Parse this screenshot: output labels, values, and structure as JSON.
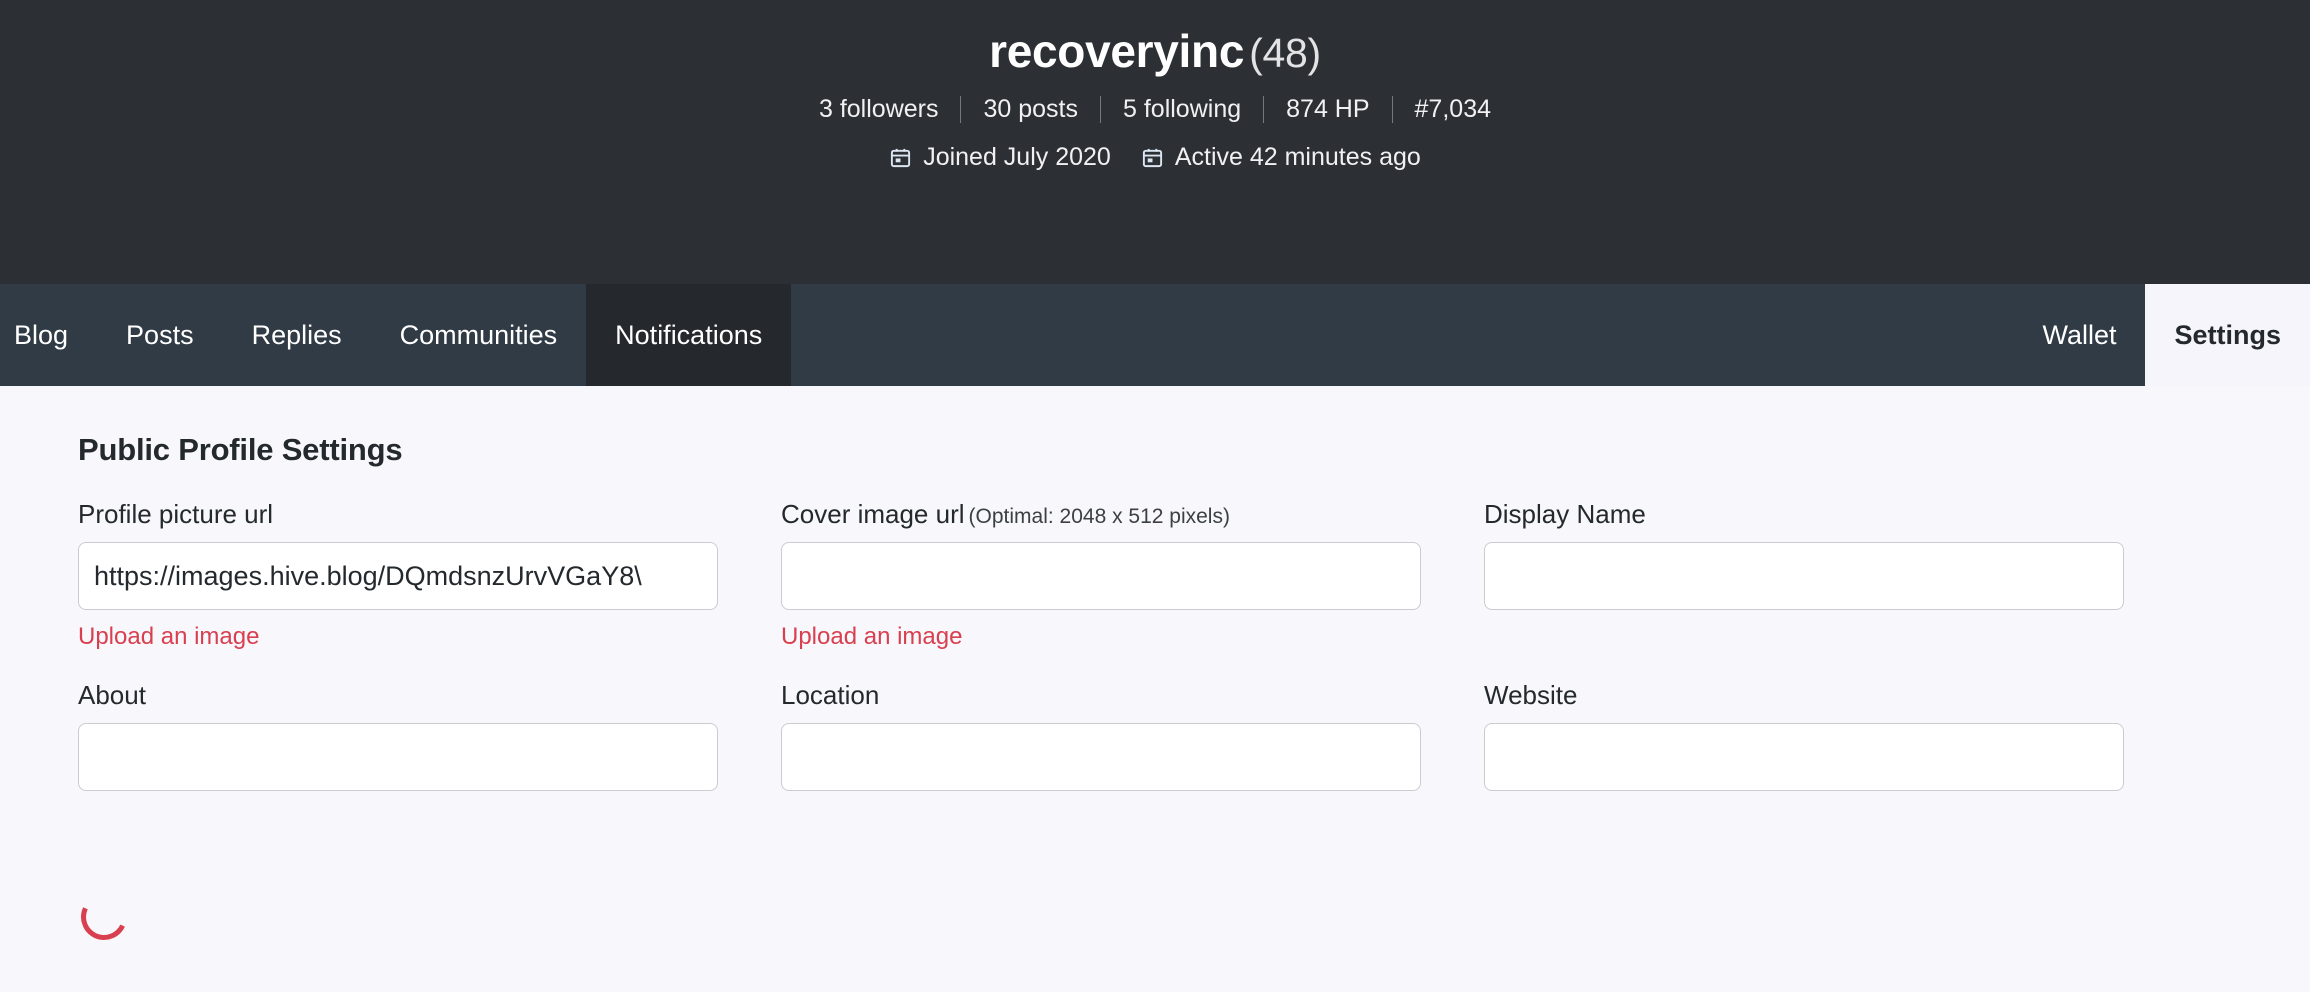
{
  "profile": {
    "username": "recoveryinc",
    "reputation": "(48)",
    "stats": [
      {
        "label": "3 followers"
      },
      {
        "label": "30 posts"
      },
      {
        "label": "5 following"
      },
      {
        "label": "874 HP"
      },
      {
        "label": "#7,034"
      }
    ],
    "meta": [
      {
        "icon": "calendar-icon",
        "label": "Joined July 2020"
      },
      {
        "icon": "calendar-icon",
        "label": "Active 42 minutes ago"
      }
    ]
  },
  "nav": {
    "left": [
      {
        "label": "Blog",
        "state": "normal"
      },
      {
        "label": "Posts",
        "state": "normal"
      },
      {
        "label": "Replies",
        "state": "normal"
      },
      {
        "label": "Communities",
        "state": "normal"
      },
      {
        "label": "Notifications",
        "state": "highlight"
      }
    ],
    "right": [
      {
        "label": "Wallet",
        "state": "normal"
      },
      {
        "label": "Settings",
        "state": "active"
      }
    ]
  },
  "settings": {
    "section_title": "Public Profile Settings",
    "fields": [
      {
        "label": "Profile picture url",
        "hint": "",
        "value": "https://images.hive.blog/DQmdsnzUrvVGaY8\\",
        "placeholder": "",
        "upload_link": "Upload an image"
      },
      {
        "label": "Cover image url",
        "hint": "(Optimal: 2048 x 512 pixels)",
        "value": "",
        "placeholder": "",
        "upload_link": "Upload an image"
      },
      {
        "label": "Display Name",
        "hint": "",
        "value": "",
        "placeholder": "",
        "upload_link": ""
      },
      {
        "label": "About",
        "hint": "",
        "value": "",
        "placeholder": "",
        "upload_link": ""
      },
      {
        "label": "Location",
        "hint": "",
        "value": "",
        "placeholder": "",
        "upload_link": ""
      },
      {
        "label": "Website",
        "hint": "",
        "value": "",
        "placeholder": "",
        "upload_link": ""
      }
    ],
    "loading_indicator": "spinner"
  },
  "colors": {
    "header_bg": "#2c2f33",
    "nav_bg": "#303b45",
    "nav_highlight": "#25282c",
    "content_bg": "#f7f7fc",
    "accent_red": "#d9404f",
    "text_dark": "#24292e"
  }
}
